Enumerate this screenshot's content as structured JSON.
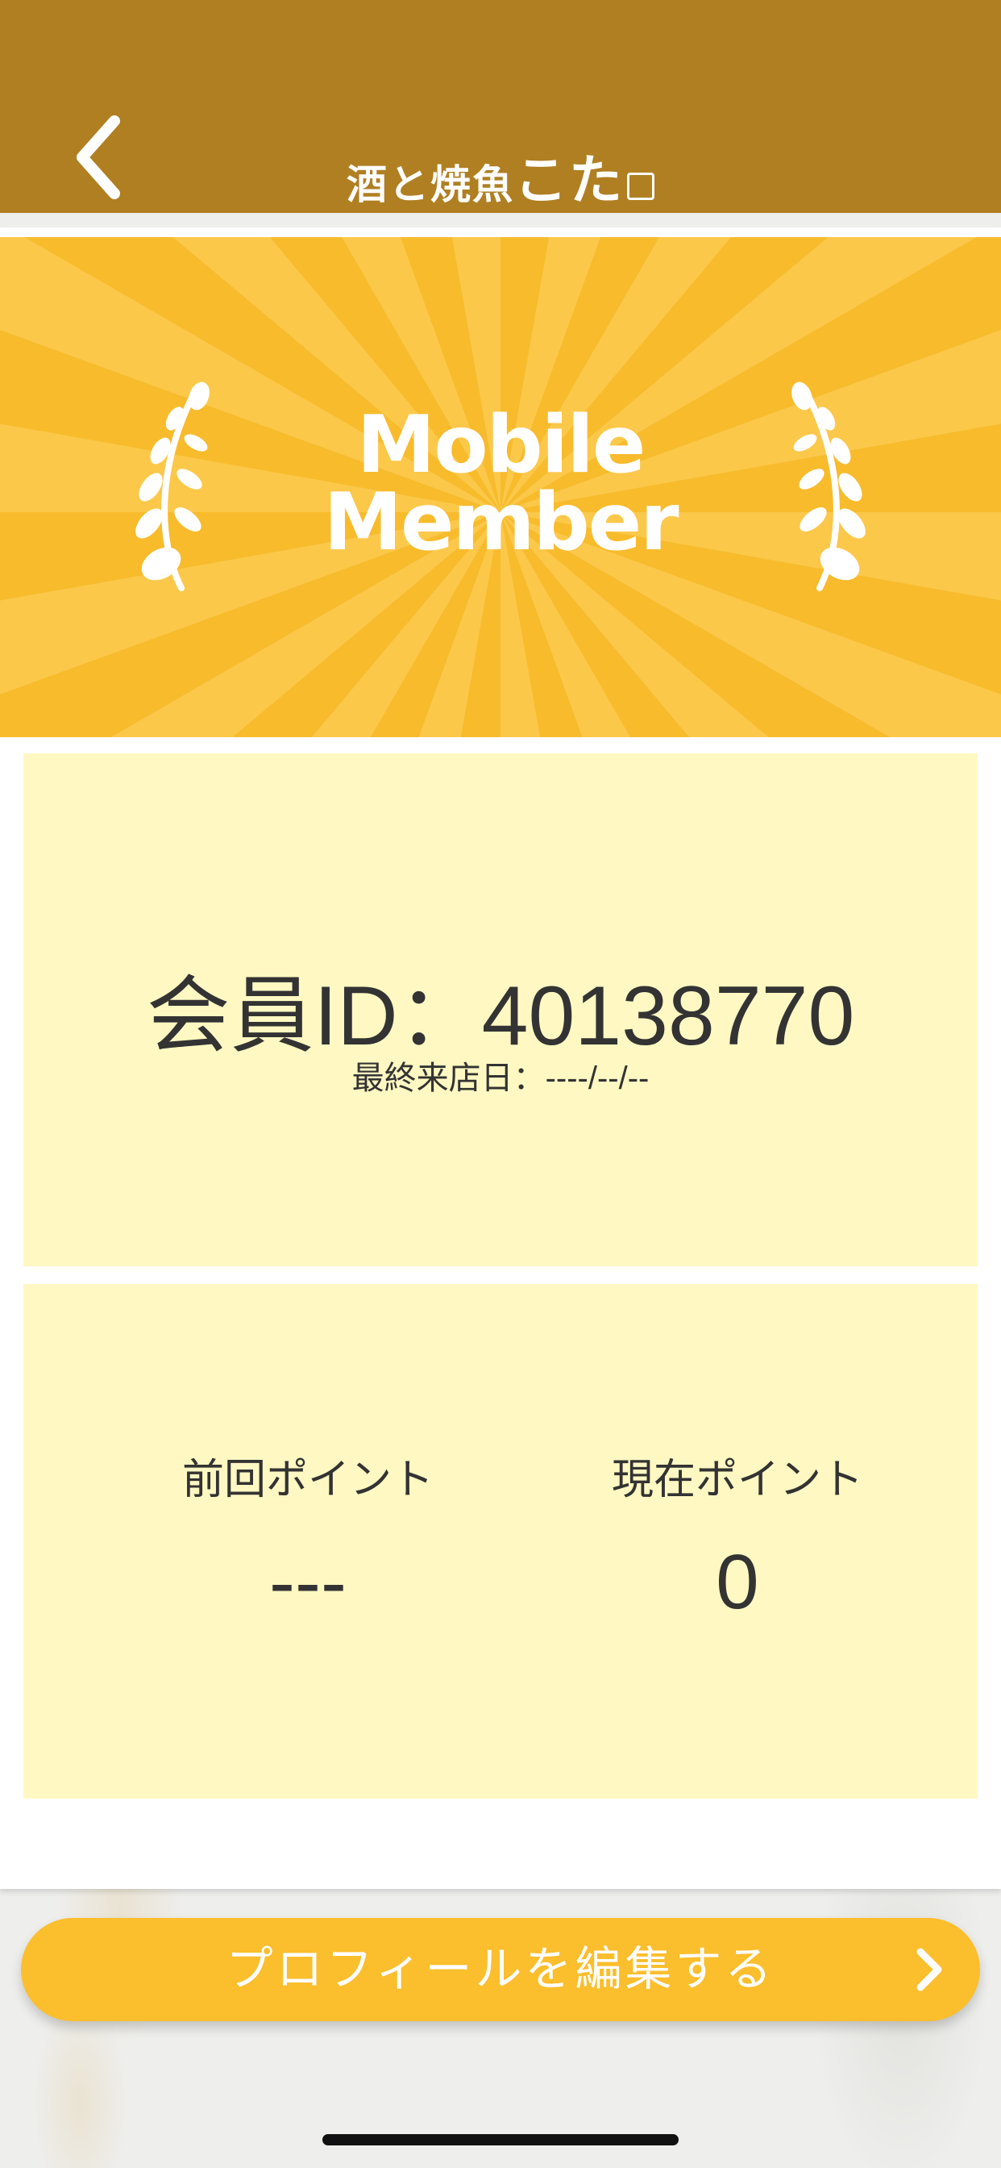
{
  "header": {
    "brand_small": "酒と焼魚",
    "brand_big": "こた"
  },
  "banner": {
    "line1": "Mobile",
    "line2": "Member"
  },
  "member": {
    "id_text": "会員ID：40138770",
    "last_visit": "最終来店日：----/--/--"
  },
  "points": {
    "previous_label": "前回ポイント",
    "previous_value": "---",
    "current_label": "現在ポイント",
    "current_value": "0"
  },
  "actions": {
    "edit_profile_label": "プロフィールを編集する"
  },
  "colors": {
    "header": "#b07f22",
    "accent": "#fbbe2c",
    "card": "#fff8c2"
  }
}
